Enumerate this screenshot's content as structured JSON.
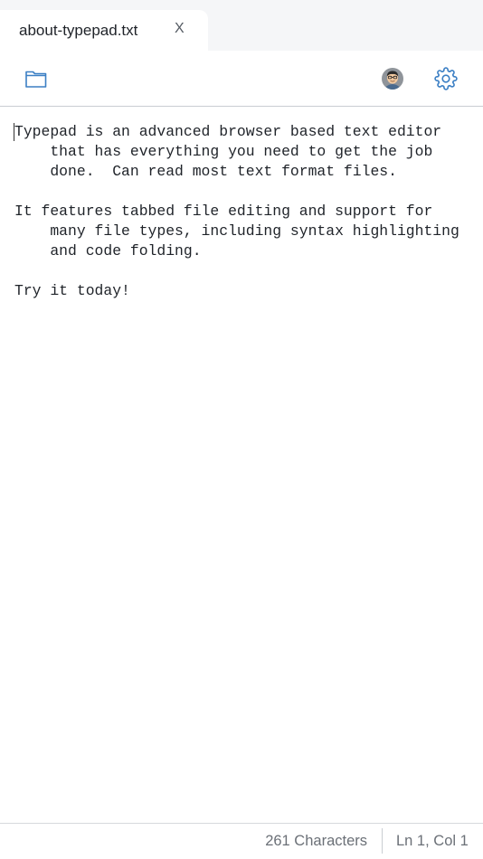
{
  "tab": {
    "filename": "about-typepad.txt",
    "close_label": "X"
  },
  "toolbar": {
    "open_icon": "folder-icon",
    "avatar_icon": "user-avatar-icon",
    "settings_icon": "gear-icon",
    "accent_color": "#3b7fc4"
  },
  "editor": {
    "content": "Typepad is an advanced browser based text editor\n    that has everything you need to get the job\n    done.  Can read most text format files.\n\nIt features tabbed file editing and support for\n    many file types, including syntax highlighting\n    and code folding.\n\nTry it today!"
  },
  "status": {
    "characters": "261 Characters",
    "position": "Ln 1, Col 1"
  }
}
